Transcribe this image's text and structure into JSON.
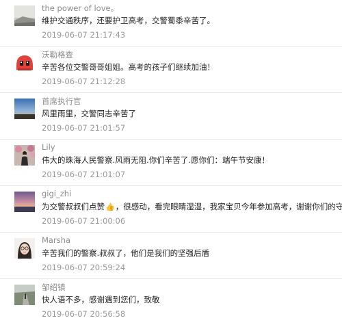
{
  "comments": [
    {
      "name": "the power of love。",
      "text": "维护交通秩序，还要护卫高考，交警蜀黍辛苦了。",
      "time": "2019-06-07 21:17:43",
      "avatar": "landscape-photo-icon"
    },
    {
      "name": "沃勒格查",
      "text": "辛苦各位交警哥哥姐姐。高考的孩子们继续加油！",
      "time": "2019-06-07 21:12:28",
      "avatar": "red-cartoon-face-icon"
    },
    {
      "name": "首席执行官",
      "text": "风里雨里，交警同志辛苦了",
      "time": "2019-06-07 21:01:57",
      "avatar": "sky-horizon-photo-icon"
    },
    {
      "name": "Lily",
      "text": "伟大的珠海人民警察.风雨无阻.你们辛苦了.愿你们：端午节安康！",
      "time": "2019-06-07 21:01:07",
      "avatar": "girl-with-flowers-photo-icon"
    },
    {
      "name": "gigi_zhi",
      "text_before": "为交警叔叔们点赞",
      "text_after": "，很感动，看完眼睛湿湿，我家宝贝今年参加高考，谢谢你们的守护！",
      "time": "2019-06-07 21:00:06",
      "avatar": "sunset-photo-icon",
      "emoji": "thumbs-up-icon"
    },
    {
      "name": "Marsha",
      "text": "辛苦我们的警察.叔叔了，他们是我们的坚强后盾",
      "time": "2019-06-07 20:59:24",
      "avatar": "woman-with-glasses-photo-icon"
    },
    {
      "name": "邹绍镇",
      "text": "快人语不多，感谢遇到您们，致敬",
      "time": "2019-06-07 20:56:58",
      "avatar": "person-on-road-photo-icon"
    }
  ],
  "colors": {
    "name": "#8c8c8c",
    "text": "#222222",
    "time": "#999999",
    "divider": "#e8e8e8"
  }
}
